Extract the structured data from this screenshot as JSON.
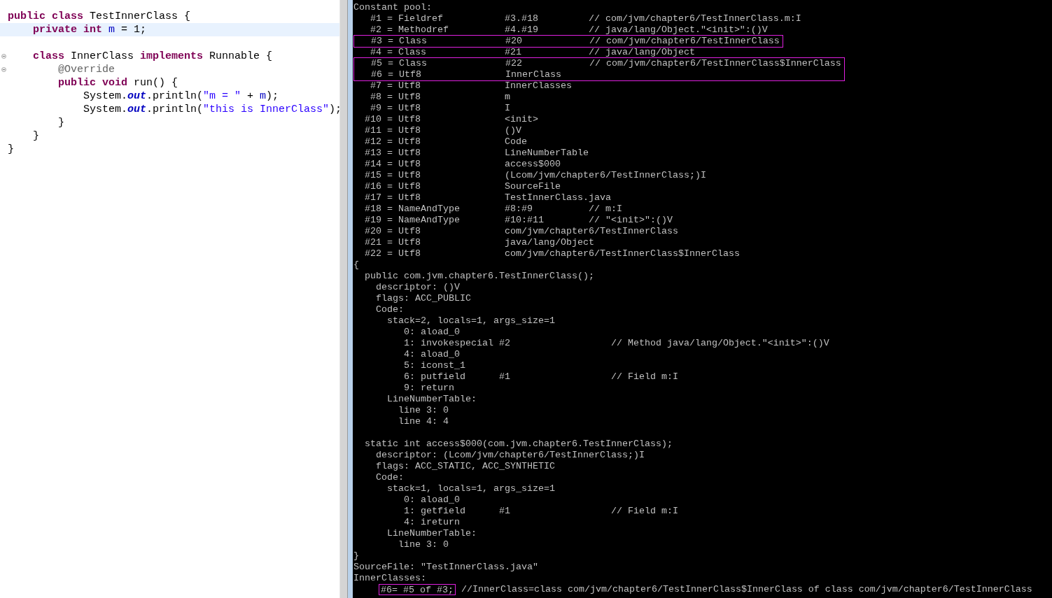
{
  "editor": {
    "lines": [
      {
        "current": false,
        "foldable": false,
        "tokens": [
          {
            "kind": "keyword",
            "text": "public"
          },
          {
            "kind": "keyword",
            "text": " class"
          },
          {
            "kind": "plain",
            "text": " TestInnerClass {"
          }
        ]
      },
      {
        "current": true,
        "foldable": false,
        "tokens": [
          {
            "kind": "keyword",
            "text": "    private"
          },
          {
            "kind": "keyword",
            "text": " int"
          },
          {
            "kind": "field",
            "text": " m"
          },
          {
            "kind": "plain",
            "text": " = 1;"
          }
        ]
      },
      {
        "current": false,
        "foldable": false
      },
      {
        "current": false,
        "foldable": true,
        "tokens": [
          {
            "kind": "keyword",
            "text": "    class"
          },
          {
            "kind": "plain",
            "text": " InnerClass "
          },
          {
            "kind": "keyword",
            "text": "implements"
          },
          {
            "kind": "plain",
            "text": " Runnable {"
          }
        ]
      },
      {
        "current": false,
        "foldable": true,
        "tokens": [
          {
            "kind": "annotation",
            "text": "        @Override"
          }
        ]
      },
      {
        "current": false,
        "foldable": false,
        "tokens": [
          {
            "kind": "keyword",
            "text": "        public"
          },
          {
            "kind": "keyword",
            "text": " void"
          },
          {
            "kind": "plain",
            "text": " run() {"
          }
        ]
      },
      {
        "current": false,
        "foldable": false,
        "tokens": [
          {
            "kind": "plain",
            "text": "            System."
          },
          {
            "kind": "static",
            "text": "out"
          },
          {
            "kind": "plain",
            "text": ".println("
          },
          {
            "kind": "string",
            "text": "\"m = \""
          },
          {
            "kind": "plain",
            "text": " + "
          },
          {
            "kind": "field",
            "text": "m"
          },
          {
            "kind": "plain",
            "text": ");"
          }
        ]
      },
      {
        "current": false,
        "foldable": false,
        "tokens": [
          {
            "kind": "plain",
            "text": "            System."
          },
          {
            "kind": "static",
            "text": "out"
          },
          {
            "kind": "plain",
            "text": ".println("
          },
          {
            "kind": "string",
            "text": "\"this is InnerClass\""
          },
          {
            "kind": "plain",
            "text": ");"
          }
        ]
      },
      {
        "current": false,
        "foldable": false,
        "tokens": [
          {
            "kind": "plain",
            "text": "        }"
          }
        ]
      },
      {
        "current": false,
        "foldable": false,
        "tokens": [
          {
            "kind": "plain",
            "text": "    }"
          }
        ]
      },
      {
        "current": false,
        "foldable": false,
        "tokens": [
          {
            "kind": "plain",
            "text": "}"
          }
        ]
      }
    ]
  },
  "console": {
    "lines": [
      {
        "kind": "line",
        "text": "Constant pool:"
      },
      {
        "kind": "line",
        "text": "   #1 = Fieldref           #3.#18         // com/jvm/chapter6/TestInnerClass.m:I"
      },
      {
        "kind": "line",
        "text": "   #2 = Methodref          #4.#19         // java/lang/Object.\"<init>\":()V"
      },
      {
        "kind": "group",
        "boxed": true,
        "lines": [
          "   #3 = Class              #20            // com/jvm/chapter6/TestInnerClass"
        ]
      },
      {
        "kind": "line",
        "text": "   #4 = Class              #21            // java/lang/Object"
      },
      {
        "kind": "group",
        "boxed": true,
        "lines": [
          "   #5 = Class              #22            // com/jvm/chapter6/TestInnerClass$InnerClass",
          "   #6 = Utf8               InnerClass"
        ]
      },
      {
        "kind": "line",
        "text": "   #7 = Utf8               InnerClasses"
      },
      {
        "kind": "line",
        "text": "   #8 = Utf8               m"
      },
      {
        "kind": "line",
        "text": "   #9 = Utf8               I"
      },
      {
        "kind": "line",
        "text": "  #10 = Utf8               <init>"
      },
      {
        "kind": "line",
        "text": "  #11 = Utf8               ()V"
      },
      {
        "kind": "line",
        "text": "  #12 = Utf8               Code"
      },
      {
        "kind": "line",
        "text": "  #13 = Utf8               LineNumberTable"
      },
      {
        "kind": "line",
        "text": "  #14 = Utf8               access$000"
      },
      {
        "kind": "line",
        "text": "  #15 = Utf8               (Lcom/jvm/chapter6/TestInnerClass;)I"
      },
      {
        "kind": "line",
        "text": "  #16 = Utf8               SourceFile"
      },
      {
        "kind": "line",
        "text": "  #17 = Utf8               TestInnerClass.java"
      },
      {
        "kind": "line",
        "text": "  #18 = NameAndType        #8:#9          // m:I"
      },
      {
        "kind": "line",
        "text": "  #19 = NameAndType        #10:#11        // \"<init>\":()V"
      },
      {
        "kind": "line",
        "text": "  #20 = Utf8               com/jvm/chapter6/TestInnerClass"
      },
      {
        "kind": "line",
        "text": "  #21 = Utf8               java/lang/Object"
      },
      {
        "kind": "line",
        "text": "  #22 = Utf8               com/jvm/chapter6/TestInnerClass$InnerClass"
      },
      {
        "kind": "line",
        "text": "{"
      },
      {
        "kind": "line",
        "text": "  public com.jvm.chapter6.TestInnerClass();"
      },
      {
        "kind": "line",
        "text": "    descriptor: ()V"
      },
      {
        "kind": "line",
        "text": "    flags: ACC_PUBLIC"
      },
      {
        "kind": "line",
        "text": "    Code:"
      },
      {
        "kind": "line",
        "text": "      stack=2, locals=1, args_size=1"
      },
      {
        "kind": "line",
        "text": "         0: aload_0"
      },
      {
        "kind": "line",
        "text": "         1: invokespecial #2                  // Method java/lang/Object.\"<init>\":()V"
      },
      {
        "kind": "line",
        "text": "         4: aload_0"
      },
      {
        "kind": "line",
        "text": "         5: iconst_1"
      },
      {
        "kind": "line",
        "text": "         6: putfield      #1                  // Field m:I"
      },
      {
        "kind": "line",
        "text": "         9: return"
      },
      {
        "kind": "line",
        "text": "      LineNumberTable:"
      },
      {
        "kind": "line",
        "text": "        line 3: 0"
      },
      {
        "kind": "line",
        "text": "        line 4: 4"
      },
      {
        "kind": "blank"
      },
      {
        "kind": "line",
        "text": "  static int access$000(com.jvm.chapter6.TestInnerClass);"
      },
      {
        "kind": "line",
        "text": "    descriptor: (Lcom/jvm/chapter6/TestInnerClass;)I"
      },
      {
        "kind": "line",
        "text": "    flags: ACC_STATIC, ACC_SYNTHETIC"
      },
      {
        "kind": "line",
        "text": "    Code:"
      },
      {
        "kind": "line",
        "text": "      stack=1, locals=1, args_size=1"
      },
      {
        "kind": "line",
        "text": "         0: aload_0"
      },
      {
        "kind": "line",
        "text": "         1: getfield      #1                  // Field m:I"
      },
      {
        "kind": "line",
        "text": "         4: ireturn"
      },
      {
        "kind": "line",
        "text": "      LineNumberTable:"
      },
      {
        "kind": "line",
        "text": "        line 3: 0"
      },
      {
        "kind": "line",
        "text": "}"
      },
      {
        "kind": "line",
        "text": "SourceFile: \"TestInnerClass.java\""
      },
      {
        "kind": "line",
        "text": "InnerClasses:"
      },
      {
        "kind": "parts",
        "parts": [
          {
            "text": "#6= #5 of #3;",
            "boxed": true
          },
          {
            "text": " //InnerClass=class com/jvm/chapter6/TestInnerClass$InnerClass of class com/jvm/chapter6/TestInnerClass",
            "boxed": false
          }
        ]
      }
    ]
  }
}
